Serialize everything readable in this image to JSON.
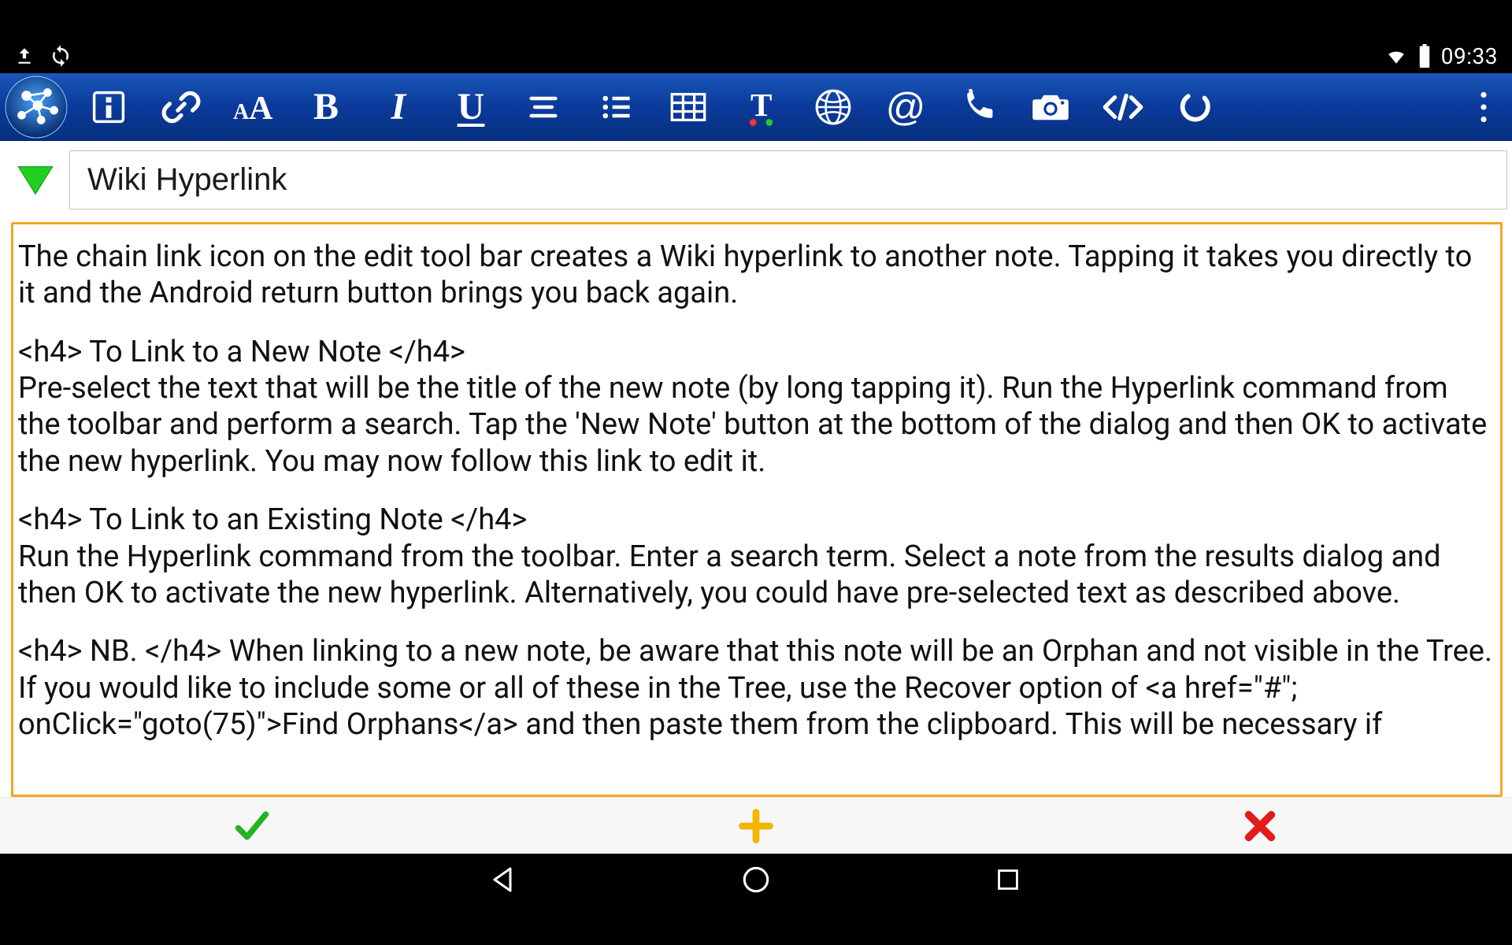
{
  "statusbar": {
    "clock": "09:33",
    "upload_icon": "upload-icon",
    "sync_icon": "sync-icon",
    "wifi_icon": "wifi-icon",
    "battery_icon": "battery-icon"
  },
  "toolbar": {
    "logo": "app-network-logo",
    "buttons": {
      "info": "info-icon",
      "link": "link-icon",
      "textsize_label": "A",
      "bold_label": "B",
      "italic_label": "I",
      "underline_label": "U",
      "align": "align-icon",
      "list": "list-icon",
      "table": "table-icon",
      "textcolor": "text-color-icon",
      "globe": "globe-icon",
      "at_label": "@",
      "phone": "phone-icon",
      "camera": "camera-icon",
      "code": "code-icon",
      "undo": "undo-icon",
      "overflow": "overflow-menu-icon"
    }
  },
  "title": {
    "collapse": "collapse-down-icon",
    "value": "Wiki Hyperlink"
  },
  "body": {
    "p1": "The chain link icon on the edit tool bar creates a Wiki hyperlink to another note. Tapping it takes you directly to it and the Android return button brings you back again.",
    "p2": "<h4> To Link to a New Note </h4>\nPre-select the text that will be the title of the new note (by long tapping it). Run the Hyperlink command from the toolbar and perform a search. Tap the 'New Note' button at the bottom of the dialog and then OK to activate the new hyperlink. You may now follow this link to edit it.",
    "p3": "<h4> To Link to an Existing Note </h4>\nRun the Hyperlink command from the toolbar. Enter a search term. Select a note from the results dialog and then OK to activate the new hyperlink. Alternatively, you could have pre-selected text as described above.",
    "p4": "<h4> NB. </h4> When linking to a new note, be aware that this note will be an Orphan and not visible in the Tree. If you would like to include some or all of these in the Tree, use the Recover option of <a href=\"#\"; onClick=\"goto(75)\">Find Orphans</a> and then paste them from the clipboard. This will be necessary if"
  },
  "actions": {
    "confirm": "check-icon",
    "add": "plus-icon",
    "cancel": "close-icon"
  },
  "nav": {
    "back": "back-icon",
    "home": "home-icon",
    "recent": "recent-icon"
  },
  "colors": {
    "toolbar_start": "#1a57b8",
    "toolbar_end": "#083080",
    "accent_orange": "#f5a623",
    "green": "#22b422",
    "gold": "#f2b600",
    "red": "#e31b1b"
  }
}
